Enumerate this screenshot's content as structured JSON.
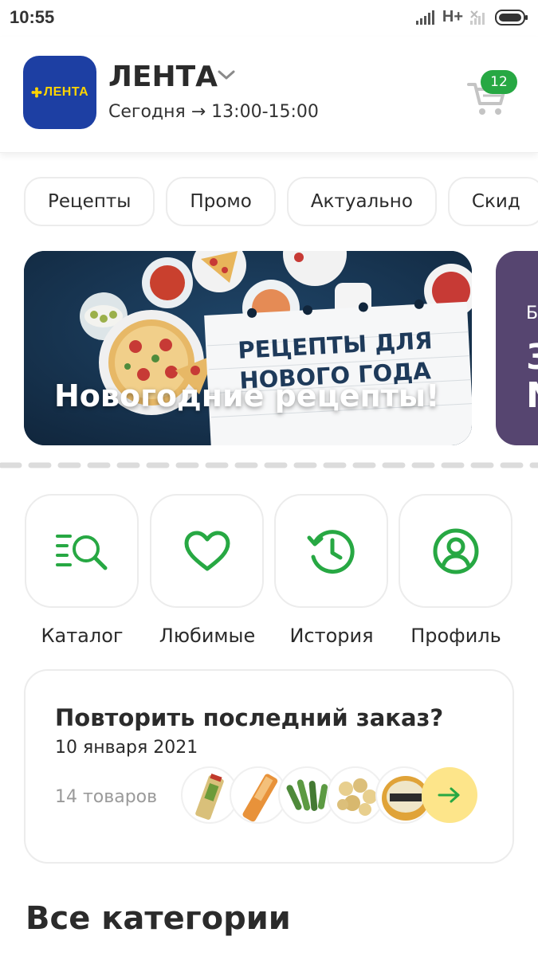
{
  "status_bar": {
    "time": "10:55",
    "network": "H+"
  },
  "header": {
    "logo_text": "ЛЕНТА",
    "store_name": "ЛЕНТА",
    "delivery_slot": "Сегодня → 13:00-15:00",
    "cart_count": "12"
  },
  "chips": [
    "Рецепты",
    "Промо",
    "Актуально",
    "Скид"
  ],
  "banner": {
    "title": "Новогодние рецепты!",
    "image_text_line1": "РЕЦЕПТЫ ДЛЯ",
    "image_text_line2": "НОВОГО ГОДА"
  },
  "banner_next": {
    "text_small": "Б",
    "text_big_1": "3",
    "text_big_2": "N"
  },
  "quick_actions": [
    {
      "label": "Каталог",
      "icon": "catalog-search-icon"
    },
    {
      "label": "Любимые",
      "icon": "heart-icon"
    },
    {
      "label": "История",
      "icon": "history-icon"
    },
    {
      "label": "Профиль",
      "icon": "profile-icon"
    }
  ],
  "repeat_order": {
    "title": "Повторить последний заказ?",
    "date": "10 января 2021",
    "items_count": "14 товаров"
  },
  "sections": {
    "all_categories": "Все категории"
  },
  "colors": {
    "accent_green": "#27a843",
    "logo_blue": "#1d3fa3",
    "logo_yellow": "#ffd400",
    "arrow_button": "#fde58a"
  }
}
